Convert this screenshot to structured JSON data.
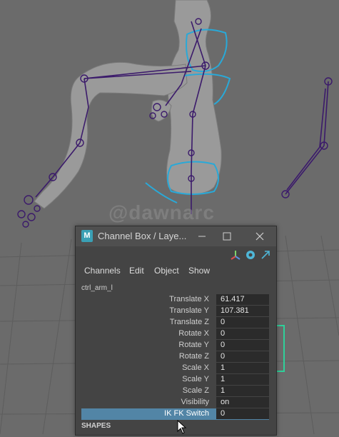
{
  "watermark": "@dawnarc",
  "window": {
    "app_icon_text": "M",
    "title": "Channel Box / Laye...",
    "minimize_icon": "minimize-icon",
    "maximize_icon": "maximize-icon",
    "close_icon": "close-icon"
  },
  "toolbar_icons": [
    "manipulator-icon",
    "channel-speed-icon",
    "expand-arrow-icon"
  ],
  "menu": [
    "Channels",
    "Edit",
    "Object",
    "Show"
  ],
  "node_name": "ctrl_arm_l",
  "channels": [
    {
      "label": "Translate X",
      "value": "61.417"
    },
    {
      "label": "Translate Y",
      "value": "107.381"
    },
    {
      "label": "Translate Z",
      "value": "0"
    },
    {
      "label": "Rotate X",
      "value": "0"
    },
    {
      "label": "Rotate Y",
      "value": "0"
    },
    {
      "label": "Rotate Z",
      "value": "0"
    },
    {
      "label": "Scale X",
      "value": "1"
    },
    {
      "label": "Scale Y",
      "value": "1"
    },
    {
      "label": "Scale Z",
      "value": "1"
    },
    {
      "label": "Visibility",
      "value": "on"
    },
    {
      "label": "IK FK Switch",
      "value": "0",
      "selected": true
    }
  ],
  "shapes_header": "SHAPES",
  "colors": {
    "viewport_bg": "#6b6b6b",
    "bone": "#3b1a6b",
    "control_curve": "#29a9d8",
    "selection": "#5285a6",
    "panel_bg": "#444444"
  }
}
